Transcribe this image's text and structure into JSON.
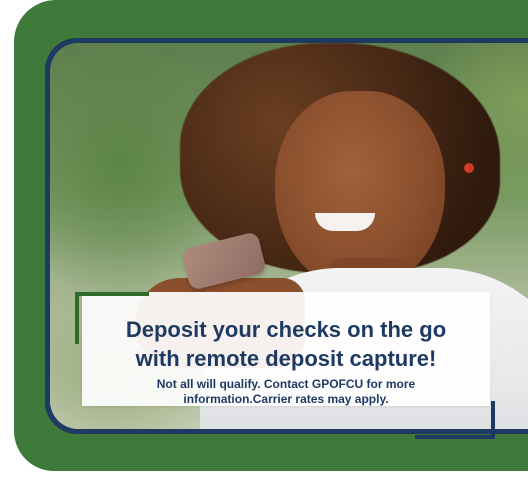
{
  "banner": {
    "heading": "Deposit your checks on the go\nwith remote deposit capture!",
    "disclaimer": "Not all will qualify. Contact GPOFCU for more\ninformation.Carrier rates may apply."
  },
  "colors": {
    "outer_frame": "#3f7a3a",
    "photo_border": "#1e3a63",
    "heading_text": "#1e3a63",
    "accent_green": "#2f6b2b",
    "accent_navy": "#1e3a63"
  },
  "icons": {
    "photo": "woman-using-phone-photo"
  }
}
